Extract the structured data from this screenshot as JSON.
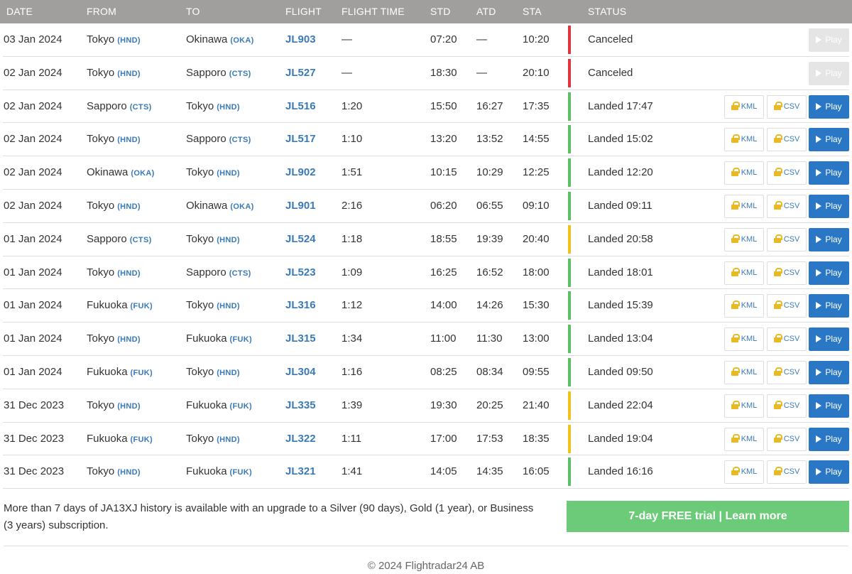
{
  "headers": {
    "date": "DATE",
    "from": "FROM",
    "to": "TO",
    "flight": "FLIGHT",
    "flight_time": "FLIGHT TIME",
    "std": "STD",
    "atd": "ATD",
    "sta": "STA",
    "status": "STATUS"
  },
  "labels": {
    "kml": "KML",
    "csv": "CSV",
    "play": "Play"
  },
  "colors": {
    "canceled": "#e0353d",
    "ontime": "#5cbf63",
    "delayed": "#f1c21b"
  },
  "rows": [
    {
      "date": "03 Jan 2024",
      "from": "Tokyo",
      "from_code": "(HND)",
      "to": "Okinawa",
      "to_code": "(OKA)",
      "flight": "JL903",
      "flight_time": "—",
      "std": "07:20",
      "atd": "—",
      "sta": "10:20",
      "status": "Canceled",
      "state": "canceled",
      "downloads": false,
      "play_enabled": false
    },
    {
      "date": "02 Jan 2024",
      "from": "Tokyo",
      "from_code": "(HND)",
      "to": "Sapporo",
      "to_code": "(CTS)",
      "flight": "JL527",
      "flight_time": "—",
      "std": "18:30",
      "atd": "—",
      "sta": "20:10",
      "status": "Canceled",
      "state": "canceled",
      "downloads": false,
      "play_enabled": false
    },
    {
      "date": "02 Jan 2024",
      "from": "Sapporo",
      "from_code": "(CTS)",
      "to": "Tokyo",
      "to_code": "(HND)",
      "flight": "JL516",
      "flight_time": "1:20",
      "std": "15:50",
      "atd": "16:27",
      "sta": "17:35",
      "status": "Landed 17:47",
      "state": "ontime",
      "downloads": true,
      "play_enabled": true
    },
    {
      "date": "02 Jan 2024",
      "from": "Tokyo",
      "from_code": "(HND)",
      "to": "Sapporo",
      "to_code": "(CTS)",
      "flight": "JL517",
      "flight_time": "1:10",
      "std": "13:20",
      "atd": "13:52",
      "sta": "14:55",
      "status": "Landed 15:02",
      "state": "ontime",
      "downloads": true,
      "play_enabled": true
    },
    {
      "date": "02 Jan 2024",
      "from": "Okinawa",
      "from_code": "(OKA)",
      "to": "Tokyo",
      "to_code": "(HND)",
      "flight": "JL902",
      "flight_time": "1:51",
      "std": "10:15",
      "atd": "10:29",
      "sta": "12:25",
      "status": "Landed 12:20",
      "state": "ontime",
      "downloads": true,
      "play_enabled": true
    },
    {
      "date": "02 Jan 2024",
      "from": "Tokyo",
      "from_code": "(HND)",
      "to": "Okinawa",
      "to_code": "(OKA)",
      "flight": "JL901",
      "flight_time": "2:16",
      "std": "06:20",
      "atd": "06:55",
      "sta": "09:10",
      "status": "Landed 09:11",
      "state": "ontime",
      "downloads": true,
      "play_enabled": true
    },
    {
      "date": "01 Jan 2024",
      "from": "Sapporo",
      "from_code": "(CTS)",
      "to": "Tokyo",
      "to_code": "(HND)",
      "flight": "JL524",
      "flight_time": "1:18",
      "std": "18:55",
      "atd": "19:39",
      "sta": "20:40",
      "status": "Landed 20:58",
      "state": "delayed",
      "downloads": true,
      "play_enabled": true
    },
    {
      "date": "01 Jan 2024",
      "from": "Tokyo",
      "from_code": "(HND)",
      "to": "Sapporo",
      "to_code": "(CTS)",
      "flight": "JL523",
      "flight_time": "1:09",
      "std": "16:25",
      "atd": "16:52",
      "sta": "18:00",
      "status": "Landed 18:01",
      "state": "ontime",
      "downloads": true,
      "play_enabled": true
    },
    {
      "date": "01 Jan 2024",
      "from": "Fukuoka",
      "from_code": "(FUK)",
      "to": "Tokyo",
      "to_code": "(HND)",
      "flight": "JL316",
      "flight_time": "1:12",
      "std": "14:00",
      "atd": "14:26",
      "sta": "15:30",
      "status": "Landed 15:39",
      "state": "ontime",
      "downloads": true,
      "play_enabled": true
    },
    {
      "date": "01 Jan 2024",
      "from": "Tokyo",
      "from_code": "(HND)",
      "to": "Fukuoka",
      "to_code": "(FUK)",
      "flight": "JL315",
      "flight_time": "1:34",
      "std": "11:00",
      "atd": "11:30",
      "sta": "13:00",
      "status": "Landed 13:04",
      "state": "ontime",
      "downloads": true,
      "play_enabled": true
    },
    {
      "date": "01 Jan 2024",
      "from": "Fukuoka",
      "from_code": "(FUK)",
      "to": "Tokyo",
      "to_code": "(HND)",
      "flight": "JL304",
      "flight_time": "1:16",
      "std": "08:25",
      "atd": "08:34",
      "sta": "09:55",
      "status": "Landed 09:50",
      "state": "ontime",
      "downloads": true,
      "play_enabled": true
    },
    {
      "date": "31 Dec 2023",
      "from": "Tokyo",
      "from_code": "(HND)",
      "to": "Fukuoka",
      "to_code": "(FUK)",
      "flight": "JL335",
      "flight_time": "1:39",
      "std": "19:30",
      "atd": "20:25",
      "sta": "21:40",
      "status": "Landed 22:04",
      "state": "delayed",
      "downloads": true,
      "play_enabled": true
    },
    {
      "date": "31 Dec 2023",
      "from": "Fukuoka",
      "from_code": "(FUK)",
      "to": "Tokyo",
      "to_code": "(HND)",
      "flight": "JL322",
      "flight_time": "1:11",
      "std": "17:00",
      "atd": "17:53",
      "sta": "18:35",
      "status": "Landed 19:04",
      "state": "delayed",
      "downloads": true,
      "play_enabled": true
    },
    {
      "date": "31 Dec 2023",
      "from": "Tokyo",
      "from_code": "(HND)",
      "to": "Fukuoka",
      "to_code": "(FUK)",
      "flight": "JL321",
      "flight_time": "1:41",
      "std": "14:05",
      "atd": "14:35",
      "sta": "16:05",
      "status": "Landed 16:16",
      "state": "ontime",
      "downloads": true,
      "play_enabled": true
    }
  ],
  "upgrade_notice": "More than 7 days of JA13XJ history is available with an upgrade to a Silver (90 days), Gold (1 year), or Business (3 years) subscription.",
  "trial_button": "7-day FREE trial | Learn more",
  "footer": "© 2024 Flightradar24 AB"
}
